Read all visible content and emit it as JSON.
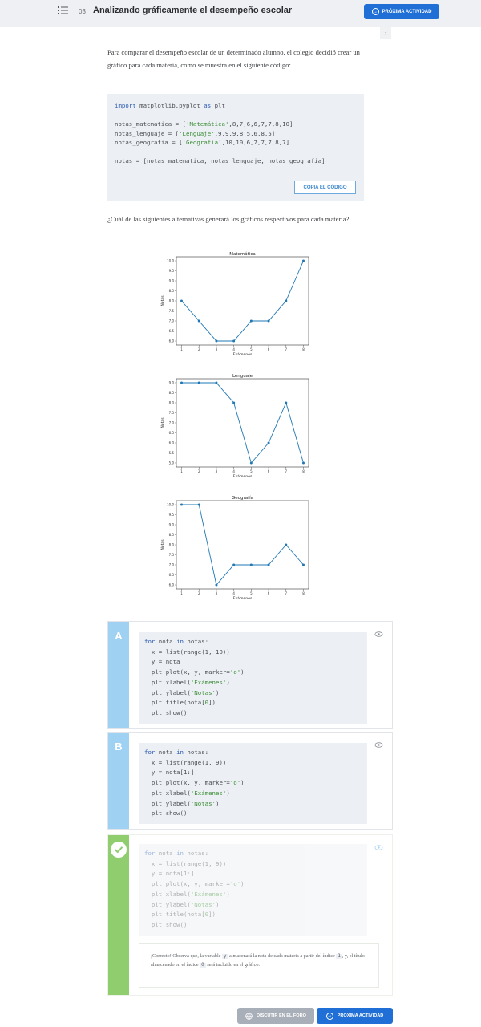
{
  "header": {
    "number": "03",
    "title": "Analizando gráficamente el desempeño escolar",
    "next_label": "PRÓXIMA ACTIVIDAD"
  },
  "kebab": "⋮",
  "intro": "Para comparar el desempeño escolar de un determinado alumno, el colegio decidió crear un gráfico para cada materia, como se muestra en el siguiente código:",
  "code": {
    "line1_kw": "import",
    "line1_rest": " matplotlib.pyplot ",
    "line1_kw2": "as",
    "line1_end": " plt",
    "mat_pre": "notas_matematica = [",
    "mat_str": "'Matemática'",
    "mat_post": ",8,7,6,6,7,7,8,10]",
    "len_pre": "notas_lenguaje = [",
    "len_str": "'Lenguaje'",
    "len_post": ",9,9,9,8,5,6,8,5]",
    "geo_pre": "notas_geografia = [",
    "geo_str": "'Geografía'",
    "geo_post": ",10,10,6,7,7,7,8,7]",
    "notas_line": "notas = [notas_matematica, notas_lenguaje, notas_geografia]",
    "copy_label": "COPIA EL CÓDIGO"
  },
  "question": "¿Cuál de las siguientes alternativas generará los gráficos respectivos para cada materia?",
  "chart_data": [
    {
      "type": "line",
      "title": "Matemática",
      "xlabel": "Exámenes",
      "ylabel": "Notas",
      "x": [
        1,
        2,
        3,
        4,
        5,
        6,
        7,
        8
      ],
      "values": [
        8,
        7,
        6,
        6,
        7,
        7,
        8,
        10
      ],
      "ylim": [
        6,
        10
      ],
      "yticks": [
        "6.0",
        "6.5",
        "7.0",
        "7.5",
        "8.0",
        "8.5",
        "9.0",
        "9.5",
        "10.0"
      ],
      "color": "#1f77b4",
      "marker": "o"
    },
    {
      "type": "line",
      "title": "Lenguaje",
      "xlabel": "Exámenes",
      "ylabel": "Notas",
      "x": [
        1,
        2,
        3,
        4,
        5,
        6,
        7,
        8
      ],
      "values": [
        9,
        9,
        9,
        8,
        5,
        6,
        8,
        5
      ],
      "ylim": [
        5,
        9
      ],
      "yticks": [
        "5.0",
        "5.5",
        "6.0",
        "6.5",
        "7.0",
        "7.5",
        "8.0",
        "8.5",
        "9.0"
      ],
      "color": "#1f77b4",
      "marker": "o"
    },
    {
      "type": "line",
      "title": "Geografía",
      "xlabel": "Exámenes",
      "ylabel": "Notas",
      "x": [
        1,
        2,
        3,
        4,
        5,
        6,
        7,
        8
      ],
      "values": [
        10,
        10,
        6,
        7,
        7,
        7,
        8,
        7
      ],
      "ylim": [
        6,
        10
      ],
      "yticks": [
        "6.0",
        "6.5",
        "7.0",
        "7.5",
        "8.0",
        "8.5",
        "9.0",
        "9.5",
        "10.0"
      ],
      "color": "#1f77b4",
      "marker": "o"
    }
  ],
  "options": {
    "a": {
      "letter": "A",
      "lines": [
        {
          "kw": "for",
          "mid": " nota ",
          "kw2": "in",
          "rest": " notas:"
        },
        {
          "text": "  x = list(range(1, 10))"
        },
        {
          "text": "  y = nota"
        },
        {
          "pre": "  plt.plot(x, y, marker=",
          "str": "'o'",
          "post": ")"
        },
        {
          "pre": "  plt.xlabel(",
          "str": "'Exámenes'",
          "post": ")"
        },
        {
          "pre": "  plt.ylabel(",
          "str": "'Notas'",
          "post": ")"
        },
        {
          "pre": "  plt.title(nota[",
          "num": "0",
          "post": "])"
        },
        {
          "text": "  plt.show()"
        }
      ]
    },
    "b": {
      "letter": "B",
      "lines": [
        {
          "kw": "for",
          "mid": " nota ",
          "kw2": "in",
          "rest": " notas:"
        },
        {
          "text": "  x = list(range(1, 9))"
        },
        {
          "text": "  y = nota[1:]"
        },
        {
          "pre": "  plt.plot(x, y, marker=",
          "str": "'o'",
          "post": ")"
        },
        {
          "pre": "  plt.xlabel(",
          "str": "'Exámenes'",
          "post": ")"
        },
        {
          "pre": "  plt.ylabel(",
          "str": "'Notas'",
          "post": ")"
        },
        {
          "text": "  plt.show()"
        }
      ]
    },
    "c": {
      "lines": [
        {
          "kw": "for",
          "mid": " nota ",
          "kw2": "in",
          "rest": " notas:"
        },
        {
          "text": "  x = list(range(1, 9))"
        },
        {
          "text": "  y = nota[1:]"
        },
        {
          "pre": "  plt.plot(x, y, marker=",
          "str": "'o'",
          "post": ")"
        },
        {
          "pre": "  plt.xlabel(",
          "str": "'Exámenes'",
          "post": ")"
        },
        {
          "pre": "  plt.ylabel(",
          "str": "'Notas'",
          "post": ")"
        },
        {
          "pre": "  plt.title(nota[",
          "num": "0",
          "post": "])"
        },
        {
          "text": "  plt.show()"
        }
      ],
      "feedback_1": "¡Correcto! Observa que, la variable ",
      "feedback_tag_y": "y",
      "feedback_2": " almacenará la nota de cada materia a partir del índice ",
      "feedback_tag_1": "1",
      "feedback_3": ", y, el título almacenado en el índice ",
      "feedback_tag_0": "0",
      "feedback_4": " será incluido en el gráfico."
    }
  },
  "footer": {
    "discuss_label": "DISCUTIR EN EL FORO",
    "next_label": "PRÓXIMA ACTIVIDAD"
  },
  "colors": {
    "accent": "#1f6fd6",
    "option_bar": "#9fd1f3",
    "correct_bar": "#8fcd6e"
  }
}
